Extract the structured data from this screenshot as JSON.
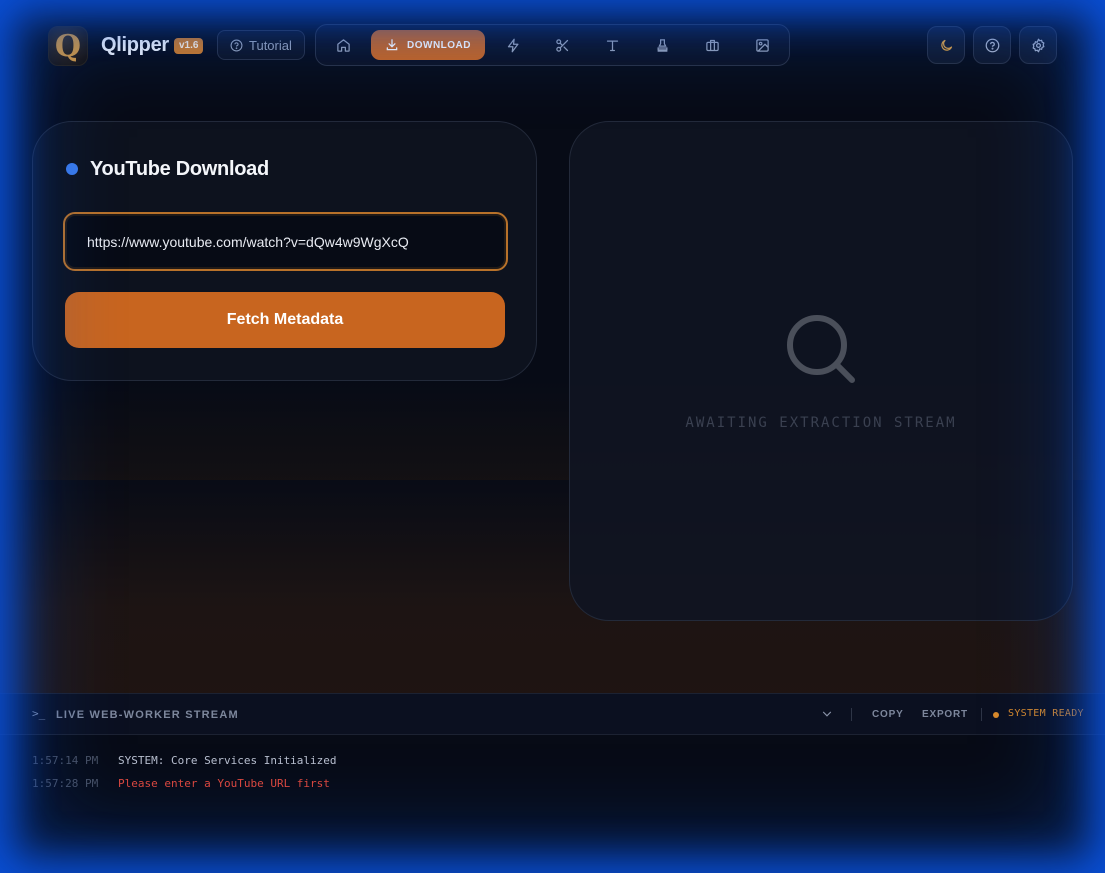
{
  "header": {
    "brand": "Qlipper",
    "logo_letter": "Q",
    "version": "v1.6",
    "tutorial_label": "Tutorial",
    "nav": {
      "active_label": "DOWNLOAD",
      "items": [
        "home-icon",
        "download-icon",
        "bolt-icon",
        "scissors-icon",
        "text-icon",
        "stamp-icon",
        "briefcase-icon",
        "image-icon"
      ]
    },
    "actions": [
      "moon-icon",
      "help-icon",
      "gear-icon"
    ]
  },
  "download_card": {
    "title": "YouTube Download",
    "url_value": "https://www.youtube.com/watch?v=dQw4w9WgXcQ",
    "fetch_label": "Fetch Metadata"
  },
  "preview": {
    "empty_text": "AWAITING EXTRACTION STREAM"
  },
  "console": {
    "prompt_glyph": ">_",
    "title": "LIVE WEB-WORKER STREAM",
    "copy_label": "COPY",
    "export_label": "EXPORT",
    "status": "SYSTEM READY",
    "logs": [
      {
        "time": "1:57:14 PM",
        "message": "SYSTEM: Core Services Initialized",
        "level": "info"
      },
      {
        "time": "1:57:28 PM",
        "message": "Please enter a YouTube URL first",
        "level": "error"
      }
    ]
  },
  "colors": {
    "accent": "#c8651f",
    "badge": "#d07a22",
    "dot": "#3b7bea",
    "error": "#e0483c",
    "frame_glow": "#0a4fd6"
  }
}
